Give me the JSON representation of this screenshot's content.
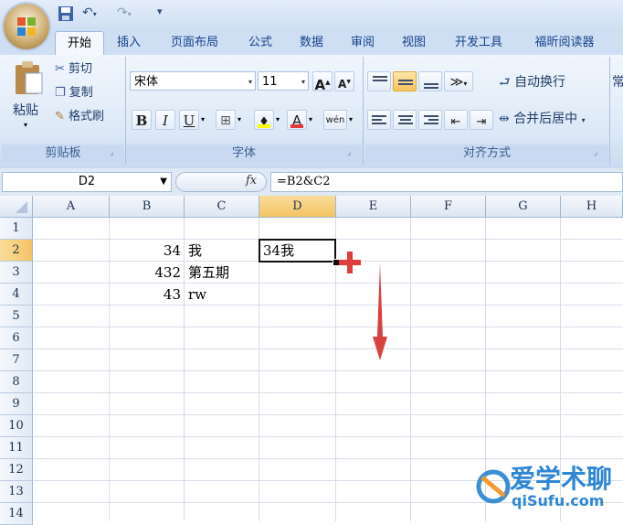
{
  "quick_access": {
    "save_icon": "save-icon",
    "undo_icon": "undo-icon",
    "redo_icon": "redo-icon",
    "customize_glyph": "▾"
  },
  "tabs": [
    "开始",
    "插入",
    "页面布局",
    "公式",
    "数据",
    "审阅",
    "视图",
    "开发工具",
    "福昕阅读器"
  ],
  "active_tab": "开始",
  "clipboard": {
    "paste": "粘贴",
    "cut": "剪切",
    "copy": "复制",
    "format_painter": "格式刷",
    "group_label": "剪贴板"
  },
  "font": {
    "font_name": "宋体",
    "font_size": "11",
    "grow": "A",
    "shrink": "A",
    "bold": "B",
    "italic": "I",
    "underline": "U",
    "font_color_letter": "A",
    "phonetic": "wén",
    "group_label": "字体"
  },
  "alignment": {
    "wrap_text": "自动换行",
    "merge_center": "合并后居中",
    "group_label": "对齐方式",
    "number_partial": "常"
  },
  "formula_bar": {
    "name_box": "D2",
    "fx": "fx",
    "formula": "=B2&C2"
  },
  "columns": [
    "A",
    "B",
    "C",
    "D",
    "E",
    "F",
    "G",
    "H"
  ],
  "rows": [
    "1",
    "2",
    "3",
    "4",
    "5",
    "6",
    "7",
    "8",
    "9",
    "10",
    "11",
    "12",
    "13",
    "14"
  ],
  "cells": {
    "B2": "34",
    "C2": "我",
    "D2": "34我",
    "B3": "432",
    "C3": "第五期",
    "B4": "43",
    "C4": "rw"
  },
  "watermark": {
    "text_top": "爱学术聊",
    "text_bottom": "qiSufu.com"
  },
  "colors": {
    "annotation_red": "#e03c3c",
    "selected_header": "#f7d07a"
  }
}
